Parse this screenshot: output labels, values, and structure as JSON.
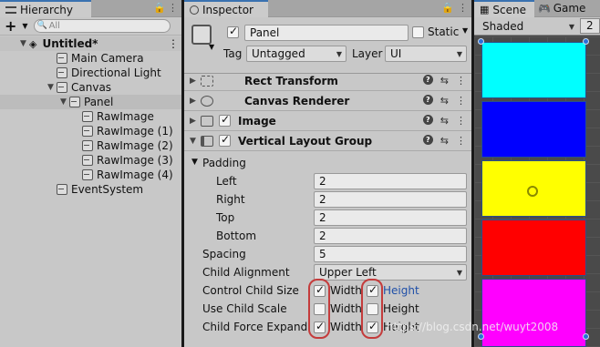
{
  "hierarchy": {
    "tab_label": "Hierarchy",
    "add_label": "+",
    "search_placeholder": "All",
    "items": [
      {
        "label": "Untitled*"
      },
      {
        "label": "Main Camera"
      },
      {
        "label": "Directional Light"
      },
      {
        "label": "Canvas"
      },
      {
        "label": "Panel"
      },
      {
        "label": "RawImage"
      },
      {
        "label": "RawImage (1)"
      },
      {
        "label": "RawImage (2)"
      },
      {
        "label": "RawImage (3)"
      },
      {
        "label": "RawImage (4)"
      },
      {
        "label": "EventSystem"
      }
    ]
  },
  "inspector": {
    "tab_label": "Inspector",
    "object_name": "Panel",
    "static_label": "Static",
    "tag_label": "Tag",
    "tag_value": "Untagged",
    "layer_label": "Layer",
    "layer_value": "UI",
    "components": [
      {
        "label": "Rect Transform"
      },
      {
        "label": "Canvas Renderer"
      },
      {
        "label": "Image"
      },
      {
        "label": "Vertical Layout Group"
      }
    ],
    "padding": {
      "label": "Padding",
      "left_label": "Left",
      "left_value": "2",
      "right_label": "Right",
      "right_value": "2",
      "top_label": "Top",
      "top_value": "2",
      "bottom_label": "Bottom",
      "bottom_value": "2"
    },
    "spacing_label": "Spacing",
    "spacing_value": "5",
    "child_alignment_label": "Child Alignment",
    "child_alignment_value": "Upper Left",
    "control_child_size_label": "Control Child Size",
    "use_child_scale_label": "Use Child Scale",
    "child_force_expand_label": "Child Force Expand",
    "width_label": "Width",
    "height_label": "Height"
  },
  "scene": {
    "tab_label": "Scene",
    "game_tab_label": "Game",
    "shading_value": "Shaded",
    "extra_value": "2"
  },
  "watermark": "https://blog.csdn.net/wuyt2008",
  "colors": {
    "accent": "#3a72b0",
    "highlight": "#c43c3c",
    "blocks": [
      "#00ffff",
      "#0000ff",
      "#ffff00",
      "#ff0000",
      "#ff00ff"
    ]
  }
}
